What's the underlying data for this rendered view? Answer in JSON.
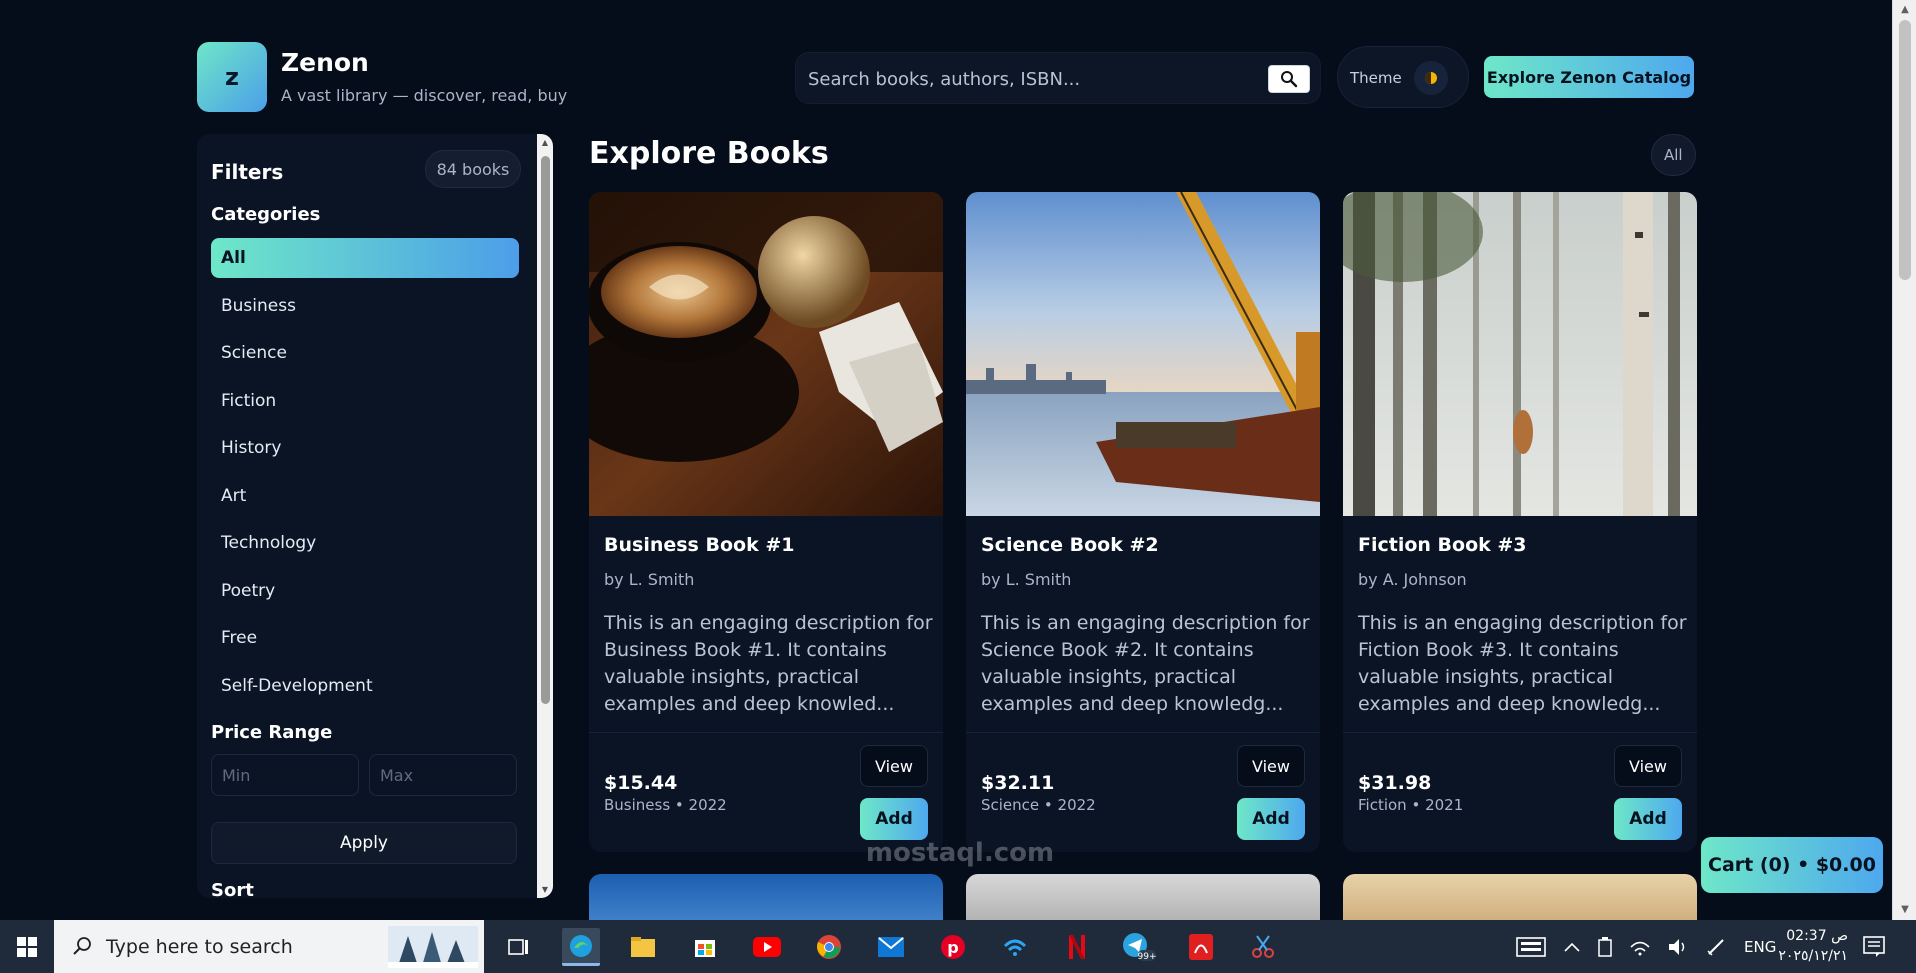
{
  "header": {
    "logo_letter": "z",
    "brand_name": "Zenon",
    "brand_tagline": "A vast library — discover, read, buy",
    "search_placeholder": "Search books, authors, ISBN...",
    "theme_label": "Theme",
    "explore_button": "Explore Zenon Catalog"
  },
  "sidebar": {
    "title": "Filters",
    "count_badge": "84 books",
    "categories_title": "Categories",
    "categories": [
      {
        "label": "All",
        "active": true
      },
      {
        "label": "Business",
        "active": false
      },
      {
        "label": "Science",
        "active": false
      },
      {
        "label": "Fiction",
        "active": false
      },
      {
        "label": "History",
        "active": false
      },
      {
        "label": "Art",
        "active": false
      },
      {
        "label": "Technology",
        "active": false
      },
      {
        "label": "Poetry",
        "active": false
      },
      {
        "label": "Free",
        "active": false
      },
      {
        "label": "Self-Development",
        "active": false
      }
    ],
    "price_title": "Price Range",
    "min_placeholder": "Min",
    "max_placeholder": "Max",
    "apply_button": "Apply",
    "sort_title": "Sort"
  },
  "main": {
    "title": "Explore Books",
    "filter_pill": "All",
    "books": [
      {
        "title": "Business Book #1",
        "author": "by L. Smith",
        "description": "This is an engaging description for Business Book #1. It contains valuable insights, practical examples and deep knowled...",
        "price": "$15.44",
        "meta": "Business • 2022",
        "view_label": "View",
        "add_label": "Add",
        "image": "coffee-cup-photo"
      },
      {
        "title": "Science Book #2",
        "author": "by L. Smith",
        "description": "This is an engaging description for Science Book #2. It contains valuable insights, practical examples and deep knowledg...",
        "price": "$32.11",
        "meta": "Science • 2022",
        "view_label": "View",
        "add_label": "Add",
        "image": "crane-barge-photo"
      },
      {
        "title": "Fiction Book #3",
        "author": "by A. Johnson",
        "description": "This is an engaging description for Fiction Book #3. It contains valuable insights, practical examples and deep knowledg...",
        "price": "$31.98",
        "meta": "Fiction • 2021",
        "view_label": "View",
        "add_label": "Add",
        "image": "misty-forest-photo"
      }
    ],
    "cart_button": "Cart (0) • $0.00"
  },
  "watermark": "mostaql.com",
  "taskbar": {
    "search_text": "Type here to search",
    "language": "ENG",
    "time": "02:37 ص",
    "date": "٢٠٢٥/١٢/٢١",
    "badge": "99+"
  },
  "colors": {
    "background": "#050c1a",
    "panel": "#0b1424",
    "accent_start": "#6ee7c8",
    "accent_end": "#4c9ee8"
  }
}
